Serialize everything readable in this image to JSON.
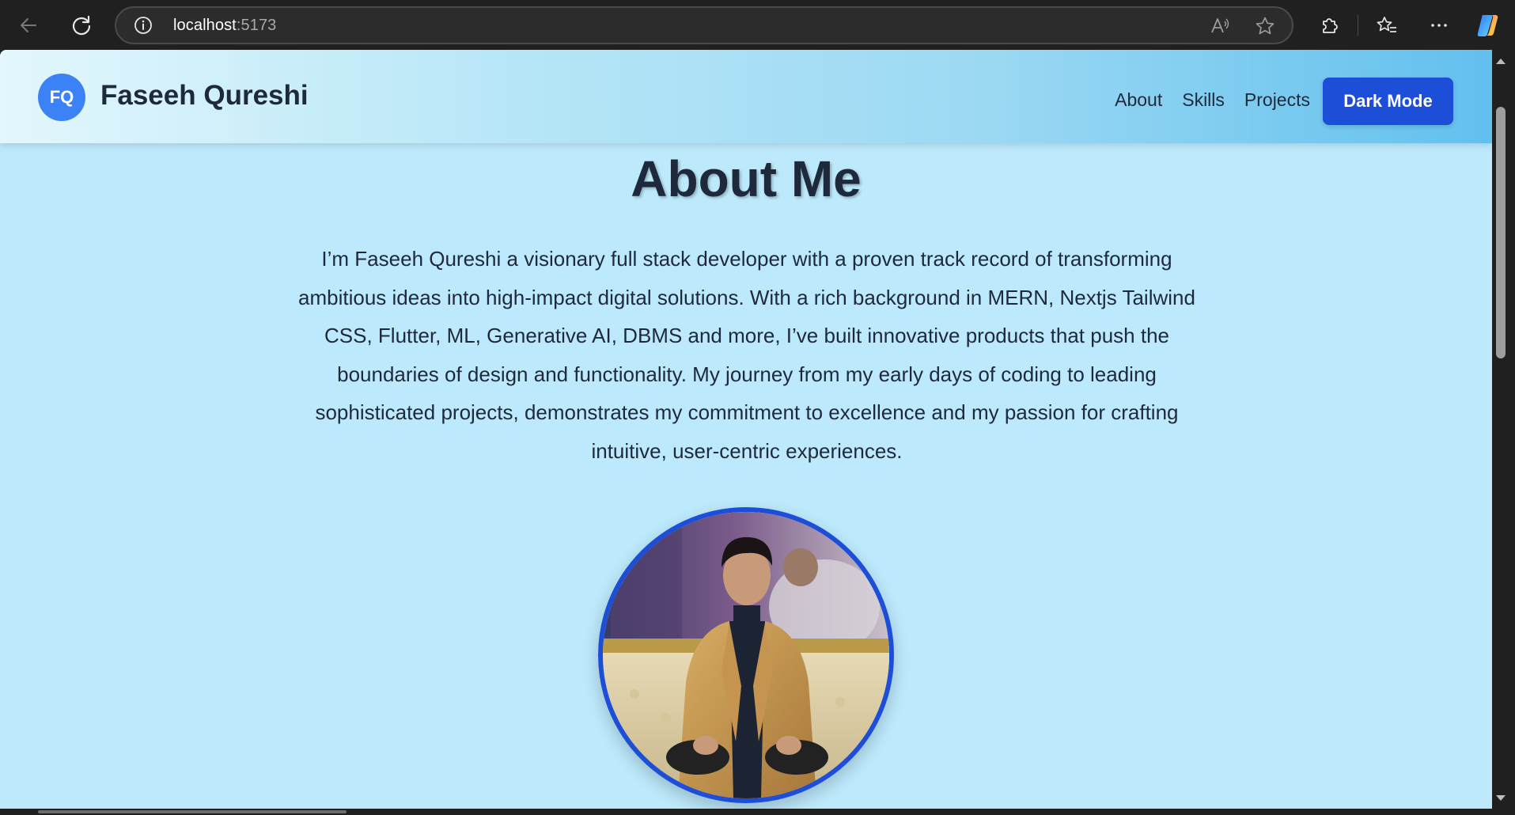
{
  "browser": {
    "url_host": "localhost",
    "url_port": ":5173",
    "icons": {
      "back": "back-arrow-icon",
      "reload": "reload-icon",
      "info": "info-icon",
      "read_aloud": "read-aloud-icon",
      "favorite": "star-icon",
      "extensions": "extensions-icon",
      "favorites": "favorites-icon",
      "more": "more-icon",
      "copilot": "copilot-icon"
    }
  },
  "navbar": {
    "logo_initials": "FQ",
    "brand": "Faseeh Qureshi",
    "links": [
      {
        "label": "About"
      },
      {
        "label": "Skills"
      },
      {
        "label": "Projects"
      }
    ],
    "dark_mode_label": "Dark Mode"
  },
  "about": {
    "title": "About Me",
    "paragraph": "I’m Faseeh Qureshi a visionary full stack developer with a proven track record of transforming ambitious ideas into high-impact digital solutions. With a rich background in MERN, Nextjs Tailwind CSS, Flutter, ML, Generative AI, DBMS and more, I’ve built innovative products that push the boundaries of design and functionality. My journey from my early days of coding to leading sophisticated projects, demonstrates my commitment to excellence and my passion for crafting intuitive, user-centric experiences."
  },
  "colors": {
    "page_bg": "#bce9fb",
    "accent": "#1d4ed8",
    "logo_bg": "#3b82f6",
    "text": "#1e293b"
  }
}
